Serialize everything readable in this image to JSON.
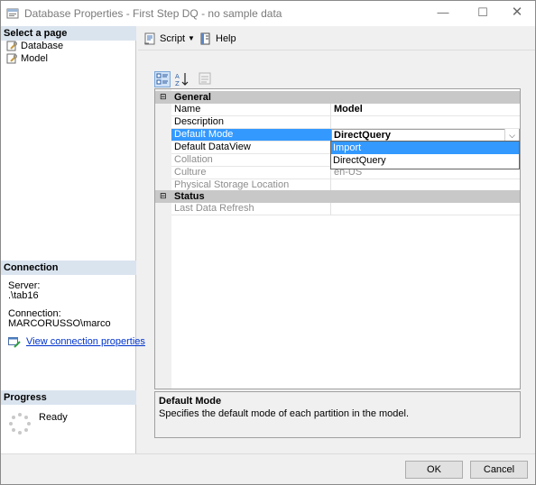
{
  "window": {
    "title": "Database Properties - First Step DQ - no sample data",
    "minimize_glyph": "—",
    "maximize_glyph": "☐",
    "close_glyph": "✕"
  },
  "sidebar": {
    "select_page_header": "Select a page",
    "pages": [
      {
        "label": "Database",
        "icon": "wrench-page-icon"
      },
      {
        "label": "Model",
        "icon": "wrench-page-icon"
      }
    ],
    "connection_header": "Connection",
    "server_label": "Server:",
    "server_value": ".\\tab16",
    "connection_label": "Connection:",
    "connection_value": "MARCORUSSO\\marco",
    "view_connection_link": "View connection properties",
    "progress_header": "Progress",
    "progress_status": "Ready"
  },
  "toolbar": {
    "script_label": "Script",
    "script_caret": "▼",
    "help_label": "Help"
  },
  "property_grid": {
    "categories": [
      {
        "name": "General",
        "toggle": "⊟",
        "properties": [
          {
            "name": "Name",
            "value": "Model"
          },
          {
            "name": "Description",
            "value": ""
          },
          {
            "name": "Default Mode",
            "value": "DirectQuery"
          },
          {
            "name": "Default DataView",
            "value": ""
          },
          {
            "name": "Collation",
            "value": ""
          },
          {
            "name": "Culture",
            "value": "en-US"
          },
          {
            "name": "Physical Storage Location",
            "value": ""
          }
        ]
      },
      {
        "name": "Status",
        "toggle": "⊟",
        "properties": [
          {
            "name": "Last Data Refresh",
            "value": ""
          }
        ]
      }
    ],
    "dropdown_arrow": "⌵",
    "dropdown_options": [
      "Import",
      "DirectQuery"
    ],
    "highlighted_option": "Import"
  },
  "description": {
    "title": "Default Mode",
    "text": "Specifies the default mode of each partition in the model."
  },
  "buttons": {
    "ok": "OK",
    "cancel": "Cancel"
  },
  "colors": {
    "selection": "#3399ff",
    "section_header": "#dae4ef",
    "link": "#0033cc"
  }
}
